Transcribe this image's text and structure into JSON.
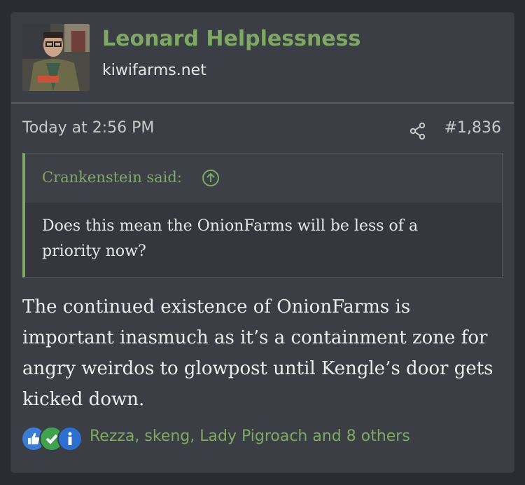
{
  "author": {
    "name": "Leonard Helplessness",
    "title": "kiwifarms.net"
  },
  "post": {
    "timestamp": "Today at 2:56 PM",
    "number": "#1,836",
    "quote": {
      "author_line": "Crankenstein said:",
      "text": "Does this mean the OnionFarms will be less of a priority now?"
    },
    "body": "The continued existence of OnionFarms is important inasmuch as it’s a containment zone for angry weirdos to glowpost until Kengle’s door gets kicked down.",
    "reactions": {
      "icons": [
        "thumbs-up-icon",
        "checkmark-icon",
        "info-icon"
      ],
      "summary": "Rezza, skeng, Lady Pigroach and 8 others"
    }
  },
  "colors": {
    "accent": "#7fa962",
    "card_bg": "#3b3e45",
    "page_bg": "#2a2c31"
  }
}
